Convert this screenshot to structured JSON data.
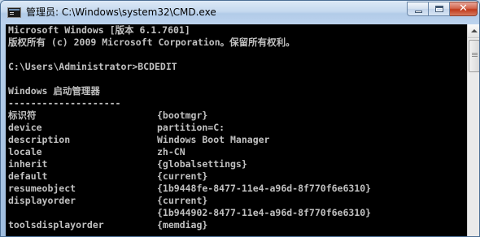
{
  "window": {
    "title": "管理员: C:\\Windows\\system32\\CMD.exe",
    "icon": "cmd-icon"
  },
  "caption_buttons": {
    "minimize_icon": "minimize-icon",
    "maximize_icon": "maximize-icon",
    "close_icon": "close-icon",
    "close_glyph": "✕"
  },
  "console": {
    "lines": [
      "Microsoft Windows [版本 6.1.7601]",
      "版权所有 (c) 2009 Microsoft Corporation。保留所有权利。",
      "",
      "C:\\Users\\Administrator>BCDEDIT",
      "",
      "Windows 启动管理器",
      "--------------------"
    ],
    "entries": [
      {
        "key": "标识符",
        "value": "{bootmgr}"
      },
      {
        "key": "device",
        "value": "partition=C:"
      },
      {
        "key": "description",
        "value": "Windows Boot Manager"
      },
      {
        "key": "locale",
        "value": "zh-CN"
      },
      {
        "key": "inherit",
        "value": "{globalsettings}"
      },
      {
        "key": "default",
        "value": "{current}"
      },
      {
        "key": "resumeobject",
        "value": "{1b9448fe-8477-11e4-a96d-8f770f6e6310}"
      },
      {
        "key": "displayorder",
        "value": "{current}"
      },
      {
        "key": "",
        "value": "{1b944902-8477-11e4-a96d-8f770f6e6310}"
      },
      {
        "key": "toolsdisplayorder",
        "value": "{memdiag}"
      }
    ]
  },
  "colors": {
    "console_background": "#000000",
    "console_text": "#c0c0c0",
    "close_button": "#c0391b"
  }
}
